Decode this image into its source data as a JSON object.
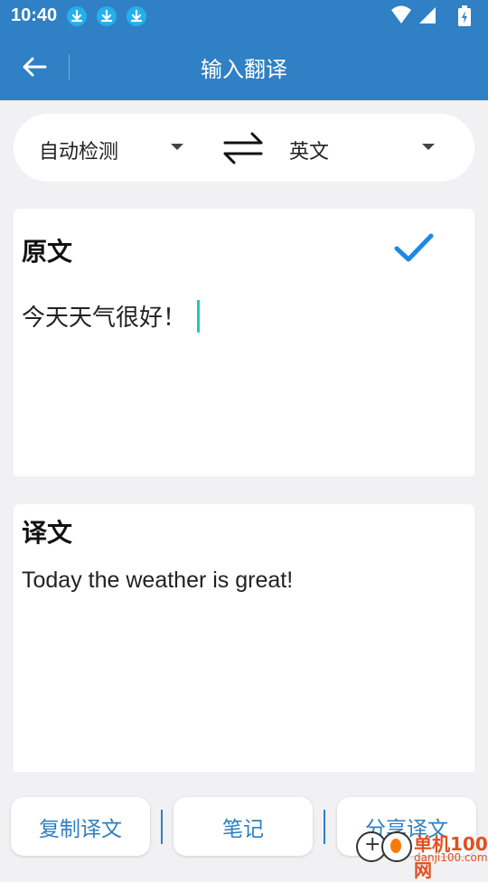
{
  "status": {
    "time": "10:40",
    "download_icons": [
      "download-icon",
      "download-icon",
      "download-icon"
    ],
    "system_icons": [
      "wifi-icon",
      "signal-icon",
      "battery-charging-icon"
    ]
  },
  "toolbar": {
    "back_icon": "arrow-left-icon",
    "title": "输入翻译"
  },
  "languages": {
    "source": "自动检测",
    "target": "英文",
    "swap_icon": "swap-arrows-icon"
  },
  "source_card": {
    "title": "原文",
    "text": "今天天气很好！",
    "confirm_icon": "check-icon"
  },
  "result_card": {
    "title": "译文",
    "text": "Today the weather is great!"
  },
  "actions": {
    "copy": "复制译文",
    "notes": "笔记",
    "share": "分享译文"
  },
  "watermark": {
    "name": "单机100网",
    "url": "danji100.com"
  },
  "colors": {
    "primary": "#2f80c5",
    "accent_check": "#1e88e5",
    "cursor": "#20c7c0",
    "background": "#f1f1f3"
  }
}
